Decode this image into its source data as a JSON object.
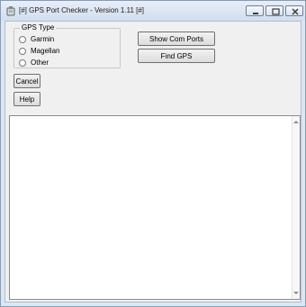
{
  "window": {
    "title": "[#] GPS Port Checker - Version 1.11 [#]",
    "icon": "gps-app-icon",
    "controls": [
      "minimize-icon",
      "maximize-icon",
      "close-icon"
    ]
  },
  "gps_type": {
    "legend": "GPS Type",
    "options": [
      "Garmin",
      "Magellan",
      "Other"
    ],
    "selected": ""
  },
  "buttons": {
    "show_com_ports": "Show Com Ports",
    "find_gps": "Find GPS",
    "cancel": "Cancel",
    "help": "Help"
  },
  "output": {
    "text": ""
  },
  "colors": {
    "accent": "#dbe6f3",
    "client": "#f0f0f0",
    "border": "#707070"
  }
}
